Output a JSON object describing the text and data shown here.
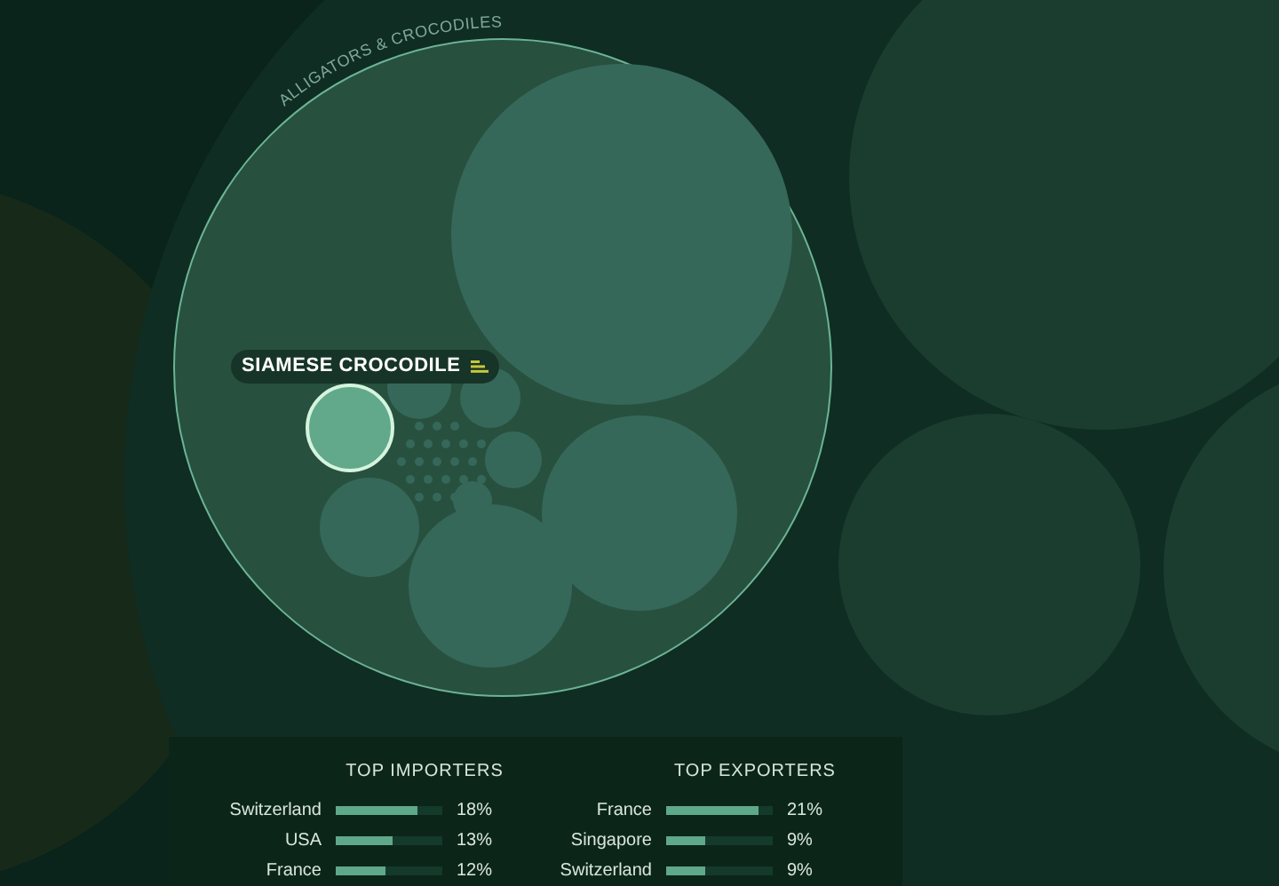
{
  "group_label": "ALLIGATORS & CROCODILES",
  "selected_species": {
    "name": "SIAMESE CROCODILE"
  },
  "top_importers": {
    "title": "TOP IMPORTERS",
    "rows": [
      {
        "country": "Switzerland",
        "share": "18%",
        "level": 0.77
      },
      {
        "country": "USA",
        "share": "13%",
        "level": 0.53
      },
      {
        "country": "France",
        "share": "12%",
        "level": 0.47
      }
    ]
  },
  "top_exporters": {
    "title": "TOP EXPORTERS",
    "rows": [
      {
        "country": "France",
        "share": "21%",
        "level": 0.87
      },
      {
        "country": "Singapore",
        "share": "9%",
        "level": 0.37
      },
      {
        "country": "Switzerland",
        "share": "9%",
        "level": 0.37
      }
    ]
  }
}
